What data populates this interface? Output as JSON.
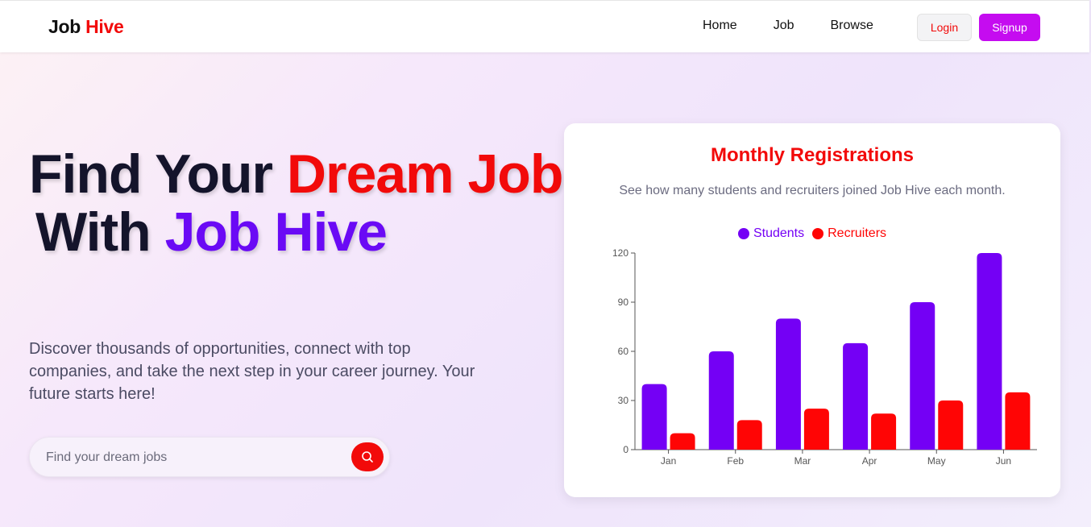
{
  "navbar": {
    "brand_prefix": "Job",
    "brand_accent": "Hive",
    "links": [
      "Home",
      "Job",
      "Browse"
    ],
    "login_label": "Login",
    "signup_label": "Signup"
  },
  "hero": {
    "title_part1": "Find Your ",
    "title_part2": "Dream Job",
    "title_part3": "With",
    "title_part4": "Job Hive",
    "description": "Discover thousands of opportunities, connect with top companies, and take the next step in your career journey. Your future starts here!",
    "search_placeholder": "Find your dream jobs"
  },
  "card": {
    "title": "Monthly Registrations",
    "subtitle": "See how many students and recruiters joined Job Hive each month."
  },
  "chart_data": {
    "type": "bar",
    "categories": [
      "Jan",
      "Feb",
      "Mar",
      "Apr",
      "May",
      "Jun"
    ],
    "series": [
      {
        "name": "Students",
        "color": "#7400f5",
        "values": [
          40,
          60,
          80,
          65,
          90,
          120
        ]
      },
      {
        "name": "Recruiters",
        "color": "#ff0505",
        "values": [
          10,
          18,
          25,
          22,
          30,
          35
        ]
      }
    ],
    "ylim": [
      0,
      120
    ],
    "yticks": [
      0,
      30,
      60,
      90,
      120
    ],
    "legend": "top-center",
    "grid": false
  },
  "colors": {
    "accent_red": "#f20a0a",
    "accent_purple": "#6a0af5",
    "signup": "#c50cf0"
  }
}
